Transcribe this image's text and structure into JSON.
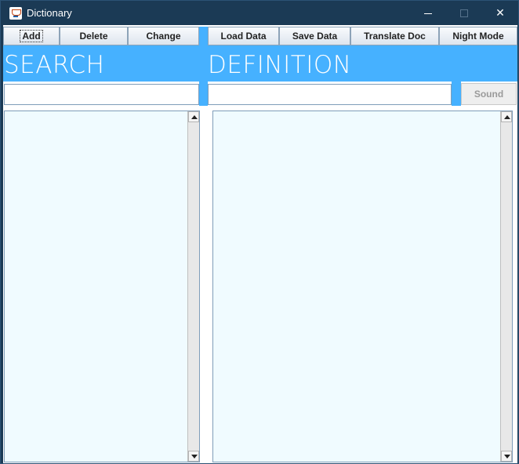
{
  "window": {
    "title": "Dictionary",
    "controls": {
      "minimize": "minimize",
      "maximize": "maximize",
      "close": "✕"
    }
  },
  "toolbar": {
    "add": "Add",
    "delete": "Delete",
    "change": "Change",
    "load_data": "Load Data",
    "save_data": "Save Data",
    "translate_doc": "Translate Doc",
    "night_mode": "Night Mode"
  },
  "search": {
    "heading": "SEARCH",
    "value": "",
    "results": []
  },
  "definition": {
    "heading": "DEFINITION",
    "value": "",
    "sound_label": "Sound",
    "text": ""
  },
  "colors": {
    "accent": "#46b1ff",
    "panel_bg": "#f0fbff",
    "titlebar": "#1b3a55",
    "sound_disabled_text": "#9a9a9a"
  },
  "icons": {
    "app": "java-coffee-cup-icon"
  }
}
